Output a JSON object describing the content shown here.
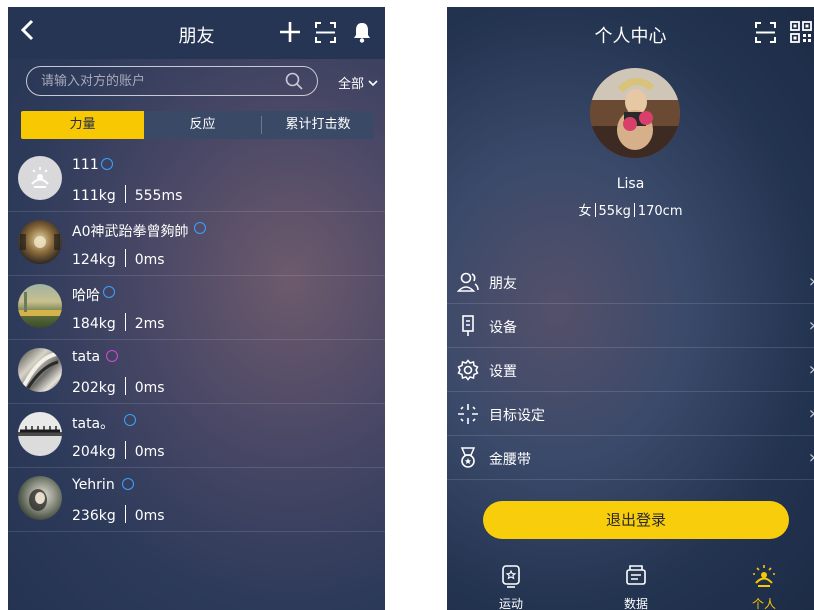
{
  "friends_screen": {
    "title": "朋友",
    "search_placeholder": "请输入对方的账户",
    "filter_label": "全部",
    "tabs": [
      {
        "label": "力量",
        "active": true
      },
      {
        "label": "反应",
        "active": false
      },
      {
        "label": "累计打击数",
        "active": false
      }
    ],
    "friends": [
      {
        "name": "111",
        "weight": "111kg",
        "value": "555ms",
        "badge_color": "#3aa3ff"
      },
      {
        "name": "A0神武跆拳曾夠帥",
        "weight": "124kg",
        "value": "0ms",
        "badge_color": "#3aa3ff"
      },
      {
        "name": "哈哈",
        "weight": "184kg",
        "value": "2ms",
        "badge_color": "#3aa3ff"
      },
      {
        "name": "tata",
        "weight": "202kg",
        "value": "0ms",
        "badge_color": "#d648d6"
      },
      {
        "name": "tata。",
        "weight": "204kg",
        "value": "0ms",
        "badge_color": "#3aa3ff"
      },
      {
        "name": "Yehrin",
        "weight": "236kg",
        "value": "0ms",
        "badge_color": "#3aa3ff"
      }
    ]
  },
  "profile_screen": {
    "title": "个人中心",
    "name": "Lisa",
    "gender": "女",
    "weight": "55kg",
    "height": "170cm",
    "menu": [
      {
        "label": "朋友",
        "icon": "friends-icon"
      },
      {
        "label": "设备",
        "icon": "device-icon"
      },
      {
        "label": "设置",
        "icon": "settings-icon"
      },
      {
        "label": "目标设定",
        "icon": "target-icon"
      },
      {
        "label": "金腰带",
        "icon": "medal-icon"
      }
    ],
    "logout_label": "退出登录",
    "bottom_nav": [
      {
        "label": "运动",
        "icon": "sport-icon",
        "active": false
      },
      {
        "label": "数据",
        "icon": "data-icon",
        "active": false
      },
      {
        "label": "个人",
        "icon": "person-icon",
        "active": true
      }
    ]
  },
  "colors": {
    "accent": "#f8c803",
    "header": "#263553",
    "badge_blue": "#3aa3ff"
  }
}
